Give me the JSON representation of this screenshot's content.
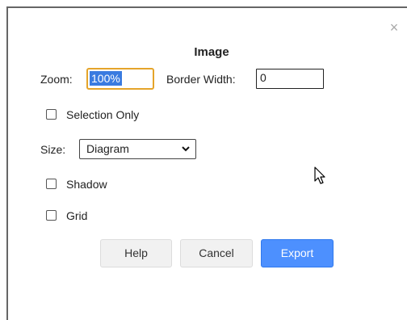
{
  "dialog": {
    "title": "Image",
    "close_icon": "close-icon",
    "zoom": {
      "label": "Zoom:",
      "value": "100%"
    },
    "border_width": {
      "label": "Border Width:",
      "value": "0"
    },
    "selection_only": {
      "label": "Selection Only",
      "checked": false
    },
    "size": {
      "label": "Size:",
      "value": "Diagram"
    },
    "shadow": {
      "label": "Shadow",
      "checked": false
    },
    "grid": {
      "label": "Grid",
      "checked": false
    },
    "buttons": {
      "help": "Help",
      "cancel": "Cancel",
      "export": "Export"
    }
  },
  "colors": {
    "accent": "#4d90fe",
    "focus_border": "#e5a42a",
    "selection": "#3a7be0"
  }
}
